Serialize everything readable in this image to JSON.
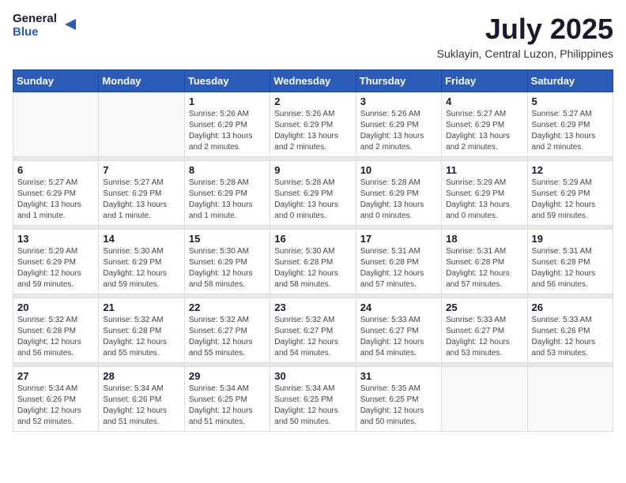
{
  "header": {
    "logo_line1": "General",
    "logo_line2": "Blue",
    "month": "July 2025",
    "location": "Suklayin, Central Luzon, Philippines"
  },
  "weekdays": [
    "Sunday",
    "Monday",
    "Tuesday",
    "Wednesday",
    "Thursday",
    "Friday",
    "Saturday"
  ],
  "weeks": [
    [
      {
        "day": "",
        "info": ""
      },
      {
        "day": "",
        "info": ""
      },
      {
        "day": "1",
        "info": "Sunrise: 5:26 AM\nSunset: 6:29 PM\nDaylight: 13 hours and 2 minutes."
      },
      {
        "day": "2",
        "info": "Sunrise: 5:26 AM\nSunset: 6:29 PM\nDaylight: 13 hours and 2 minutes."
      },
      {
        "day": "3",
        "info": "Sunrise: 5:26 AM\nSunset: 6:29 PM\nDaylight: 13 hours and 2 minutes."
      },
      {
        "day": "4",
        "info": "Sunrise: 5:27 AM\nSunset: 6:29 PM\nDaylight: 13 hours and 2 minutes."
      },
      {
        "day": "5",
        "info": "Sunrise: 5:27 AM\nSunset: 6:29 PM\nDaylight: 13 hours and 2 minutes."
      }
    ],
    [
      {
        "day": "6",
        "info": "Sunrise: 5:27 AM\nSunset: 6:29 PM\nDaylight: 13 hours and 1 minute."
      },
      {
        "day": "7",
        "info": "Sunrise: 5:27 AM\nSunset: 6:29 PM\nDaylight: 13 hours and 1 minute."
      },
      {
        "day": "8",
        "info": "Sunrise: 5:28 AM\nSunset: 6:29 PM\nDaylight: 13 hours and 1 minute."
      },
      {
        "day": "9",
        "info": "Sunrise: 5:28 AM\nSunset: 6:29 PM\nDaylight: 13 hours and 0 minutes."
      },
      {
        "day": "10",
        "info": "Sunrise: 5:28 AM\nSunset: 6:29 PM\nDaylight: 13 hours and 0 minutes."
      },
      {
        "day": "11",
        "info": "Sunrise: 5:29 AM\nSunset: 6:29 PM\nDaylight: 13 hours and 0 minutes."
      },
      {
        "day": "12",
        "info": "Sunrise: 5:29 AM\nSunset: 6:29 PM\nDaylight: 12 hours and 59 minutes."
      }
    ],
    [
      {
        "day": "13",
        "info": "Sunrise: 5:29 AM\nSunset: 6:29 PM\nDaylight: 12 hours and 59 minutes."
      },
      {
        "day": "14",
        "info": "Sunrise: 5:30 AM\nSunset: 6:29 PM\nDaylight: 12 hours and 59 minutes."
      },
      {
        "day": "15",
        "info": "Sunrise: 5:30 AM\nSunset: 6:29 PM\nDaylight: 12 hours and 58 minutes."
      },
      {
        "day": "16",
        "info": "Sunrise: 5:30 AM\nSunset: 6:28 PM\nDaylight: 12 hours and 58 minutes."
      },
      {
        "day": "17",
        "info": "Sunrise: 5:31 AM\nSunset: 6:28 PM\nDaylight: 12 hours and 57 minutes."
      },
      {
        "day": "18",
        "info": "Sunrise: 5:31 AM\nSunset: 6:28 PM\nDaylight: 12 hours and 57 minutes."
      },
      {
        "day": "19",
        "info": "Sunrise: 5:31 AM\nSunset: 6:28 PM\nDaylight: 12 hours and 56 minutes."
      }
    ],
    [
      {
        "day": "20",
        "info": "Sunrise: 5:32 AM\nSunset: 6:28 PM\nDaylight: 12 hours and 56 minutes."
      },
      {
        "day": "21",
        "info": "Sunrise: 5:32 AM\nSunset: 6:28 PM\nDaylight: 12 hours and 55 minutes."
      },
      {
        "day": "22",
        "info": "Sunrise: 5:32 AM\nSunset: 6:27 PM\nDaylight: 12 hours and 55 minutes."
      },
      {
        "day": "23",
        "info": "Sunrise: 5:32 AM\nSunset: 6:27 PM\nDaylight: 12 hours and 54 minutes."
      },
      {
        "day": "24",
        "info": "Sunrise: 5:33 AM\nSunset: 6:27 PM\nDaylight: 12 hours and 54 minutes."
      },
      {
        "day": "25",
        "info": "Sunrise: 5:33 AM\nSunset: 6:27 PM\nDaylight: 12 hours and 53 minutes."
      },
      {
        "day": "26",
        "info": "Sunrise: 5:33 AM\nSunset: 6:26 PM\nDaylight: 12 hours and 53 minutes."
      }
    ],
    [
      {
        "day": "27",
        "info": "Sunrise: 5:34 AM\nSunset: 6:26 PM\nDaylight: 12 hours and 52 minutes."
      },
      {
        "day": "28",
        "info": "Sunrise: 5:34 AM\nSunset: 6:26 PM\nDaylight: 12 hours and 51 minutes."
      },
      {
        "day": "29",
        "info": "Sunrise: 5:34 AM\nSunset: 6:25 PM\nDaylight: 12 hours and 51 minutes."
      },
      {
        "day": "30",
        "info": "Sunrise: 5:34 AM\nSunset: 6:25 PM\nDaylight: 12 hours and 50 minutes."
      },
      {
        "day": "31",
        "info": "Sunrise: 5:35 AM\nSunset: 6:25 PM\nDaylight: 12 hours and 50 minutes."
      },
      {
        "day": "",
        "info": ""
      },
      {
        "day": "",
        "info": ""
      }
    ]
  ]
}
